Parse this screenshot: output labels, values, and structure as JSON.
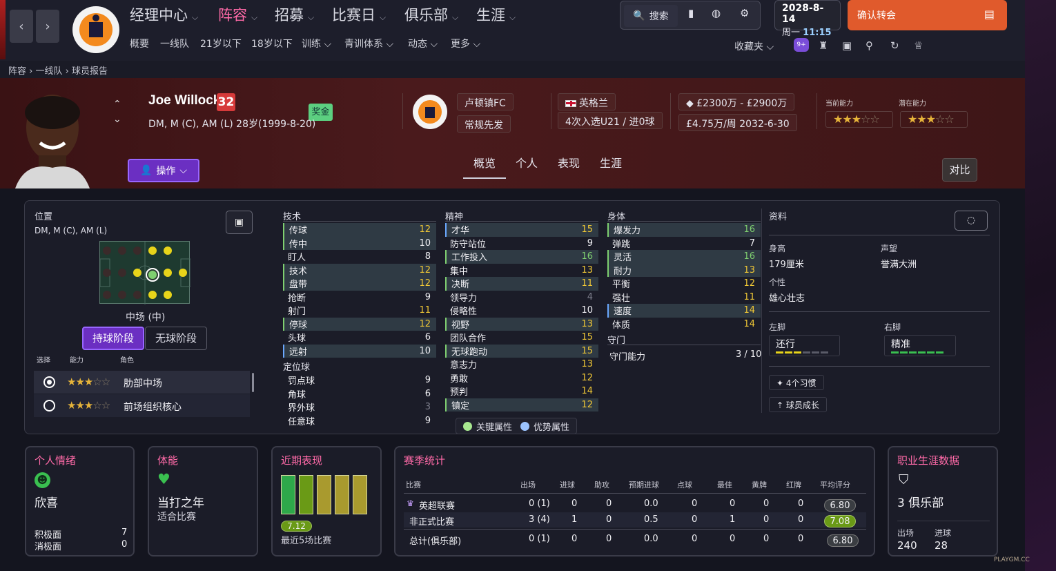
{
  "nav": {
    "main": [
      "经理中心",
      "阵容",
      "招募",
      "比赛日",
      "俱乐部",
      "生涯"
    ],
    "active_index": 1,
    "sub": [
      "概要",
      "一线队",
      "21岁以下",
      "18岁以下",
      "训练",
      "青训体系",
      "动态",
      "更多"
    ],
    "search_label": "搜索",
    "favorites_label": "收藏夹",
    "notification_badge": "9+",
    "date": "2028-8-14",
    "weekday": "周一",
    "time": "11:15",
    "confirm_label": "确认转会"
  },
  "breadcrumb": [
    "阵容",
    "一线队",
    "球员报告"
  ],
  "player": {
    "name": "Joe Willock",
    "number": "32",
    "bonus_label": "奖金",
    "info": "DM, M (C), AM (L)  28岁(1999-8-20)",
    "club": "卢顿镇FC",
    "squad_status": "常规先发",
    "nationality": "英格兰",
    "caps": "4次入选U21 / 进0球",
    "value": "£2300万 - £2900万",
    "wage": "£4.75万/周 2032-6-30",
    "ca_label": "当前能力",
    "pa_label": "潜在能力",
    "ca_stars": 3,
    "pa_stars": 3,
    "action_label": "操作",
    "compare_label": "对比",
    "tabs": [
      "概览",
      "个人",
      "表现",
      "生涯"
    ]
  },
  "position": {
    "title": "位置",
    "positions": "DM, M (C), AM (L)",
    "label": "中场 (中)",
    "phase_in": "持球阶段",
    "phase_out": "无球阶段",
    "col_select": "选择",
    "col_ability": "能力",
    "col_role": "角色",
    "roles": [
      {
        "name": "肋部中场",
        "stars": 3,
        "selected": true
      },
      {
        "name": "前场组织核心",
        "stars": 3,
        "selected": false
      }
    ]
  },
  "attributes": {
    "technical_title": "技术",
    "technical": [
      {
        "n": "传球",
        "v": 12,
        "c": "yellow",
        "hl": true,
        "mark": "key"
      },
      {
        "n": "传中",
        "v": 10,
        "c": "white",
        "hl": true,
        "mark": "key"
      },
      {
        "n": "盯人",
        "v": 8,
        "c": "white",
        "hl": false,
        "mark": ""
      },
      {
        "n": "技术",
        "v": 12,
        "c": "yellow",
        "hl": true,
        "mark": "key"
      },
      {
        "n": "盘带",
        "v": 12,
        "c": "yellow",
        "hl": true,
        "mark": "key"
      },
      {
        "n": "抢断",
        "v": 9,
        "c": "white",
        "hl": false,
        "mark": ""
      },
      {
        "n": "射门",
        "v": 11,
        "c": "yellow",
        "hl": false,
        "mark": ""
      },
      {
        "n": "停球",
        "v": 12,
        "c": "yellow",
        "hl": true,
        "mark": "key"
      },
      {
        "n": "头球",
        "v": 6,
        "c": "white",
        "hl": false,
        "mark": ""
      },
      {
        "n": "远射",
        "v": 10,
        "c": "white",
        "hl": true,
        "mark": "pref"
      }
    ],
    "setpiece_title": "定位球",
    "setpiece": [
      {
        "n": "罚点球",
        "v": 9,
        "c": "white",
        "hl": false,
        "mark": ""
      },
      {
        "n": "角球",
        "v": 6,
        "c": "white",
        "hl": false,
        "mark": ""
      },
      {
        "n": "界外球",
        "v": 3,
        "c": "grey",
        "hl": false,
        "mark": ""
      },
      {
        "n": "任意球",
        "v": 9,
        "c": "white",
        "hl": false,
        "mark": ""
      }
    ],
    "mental_title": "精神",
    "mental": [
      {
        "n": "才华",
        "v": 15,
        "c": "yellow",
        "hl": true,
        "mark": "pref"
      },
      {
        "n": "防守站位",
        "v": 9,
        "c": "white",
        "hl": false,
        "mark": ""
      },
      {
        "n": "工作投入",
        "v": 16,
        "c": "green",
        "hl": true,
        "mark": "key"
      },
      {
        "n": "集中",
        "v": 13,
        "c": "yellow",
        "hl": false,
        "mark": ""
      },
      {
        "n": "决断",
        "v": 11,
        "c": "yellow",
        "hl": true,
        "mark": "key"
      },
      {
        "n": "领导力",
        "v": 4,
        "c": "grey",
        "hl": false,
        "mark": ""
      },
      {
        "n": "侵略性",
        "v": 10,
        "c": "white",
        "hl": false,
        "mark": ""
      },
      {
        "n": "视野",
        "v": 13,
        "c": "yellow",
        "hl": true,
        "mark": "key"
      },
      {
        "n": "团队合作",
        "v": 15,
        "c": "yellow",
        "hl": false,
        "mark": ""
      },
      {
        "n": "无球跑动",
        "v": 15,
        "c": "yellow",
        "hl": true,
        "mark": "key"
      },
      {
        "n": "意志力",
        "v": 13,
        "c": "yellow",
        "hl": false,
        "mark": ""
      },
      {
        "n": "勇敢",
        "v": 12,
        "c": "yellow",
        "hl": false,
        "mark": ""
      },
      {
        "n": "预判",
        "v": 14,
        "c": "yellow",
        "hl": false,
        "mark": ""
      },
      {
        "n": "镇定",
        "v": 12,
        "c": "yellow",
        "hl": true,
        "mark": "key"
      }
    ],
    "physical_title": "身体",
    "physical": [
      {
        "n": "爆发力",
        "v": 16,
        "c": "green",
        "hl": true,
        "mark": "key"
      },
      {
        "n": "弹跳",
        "v": 7,
        "c": "white",
        "hl": false,
        "mark": ""
      },
      {
        "n": "灵活",
        "v": 16,
        "c": "green",
        "hl": true,
        "mark": "key"
      },
      {
        "n": "耐力",
        "v": 13,
        "c": "yellow",
        "hl": true,
        "mark": "key"
      },
      {
        "n": "平衡",
        "v": 12,
        "c": "yellow",
        "hl": false,
        "mark": ""
      },
      {
        "n": "强壮",
        "v": 11,
        "c": "yellow",
        "hl": false,
        "mark": ""
      },
      {
        "n": "速度",
        "v": 14,
        "c": "yellow",
        "hl": true,
        "mark": "pref"
      },
      {
        "n": "体质",
        "v": 14,
        "c": "yellow",
        "hl": false,
        "mark": ""
      }
    ],
    "gk_title": "守门",
    "gk_label": "守门能力",
    "gk_value": "3 / 10",
    "legend_key": "关键属性",
    "legend_pref": "优势属性"
  },
  "info": {
    "title": "资料",
    "height_label": "身高",
    "height": "179厘米",
    "reputation_label": "声望",
    "reputation": "誉满大洲",
    "personality_label": "个性",
    "personality": "雄心壮志",
    "left_foot_label": "左脚",
    "left_foot": "还行",
    "right_foot_label": "右脚",
    "right_foot": "精准",
    "habits": "4个习惯",
    "growth": "球员成长"
  },
  "morale": {
    "title": "个人情绪",
    "state": "欣喜",
    "pos_label": "积极面",
    "pos": "7",
    "neg_label": "消极面",
    "neg": "0"
  },
  "fitness": {
    "title": "体能",
    "state": "当打之年",
    "sub": "适合比赛"
  },
  "form": {
    "title": "近期表现",
    "rating": "7.12",
    "label": "最近5场比赛",
    "bars": [
      {
        "color": "#2ea84a"
      },
      {
        "color": "#6a9a16"
      },
      {
        "color": "#a99a2e"
      },
      {
        "color": "#a99a2e"
      },
      {
        "color": "#a99a2e"
      }
    ]
  },
  "season": {
    "title": "赛季统计",
    "headers": [
      "比赛",
      "出场",
      "进球",
      "助攻",
      "预期进球",
      "点球",
      "最佳",
      "黄牌",
      "红牌",
      "平均评分"
    ],
    "rows": [
      {
        "cells": [
          "英超联赛",
          "0 (1)",
          "0",
          "0",
          "0.0",
          "0",
          "0",
          "0",
          "0"
        ],
        "rating": "6.80",
        "rclass": "grey"
      },
      {
        "cells": [
          "非正式比赛",
          "3 (4)",
          "1",
          "0",
          "0.5",
          "0",
          "1",
          "0",
          "0"
        ],
        "rating": "7.08",
        "rclass": "green"
      },
      {
        "cells": [
          "总计(俱乐部)",
          "0 (1)",
          "0",
          "0",
          "0.0",
          "0",
          "0",
          "0",
          "0"
        ],
        "rating": "6.80",
        "rclass": "grey"
      }
    ]
  },
  "career": {
    "title": "职业生涯数据",
    "clubs": "3 俱乐部",
    "apps_label": "出场",
    "apps": "240",
    "goals_label": "进球",
    "goals": "28"
  },
  "watermark": "PLAYGM.CC"
}
